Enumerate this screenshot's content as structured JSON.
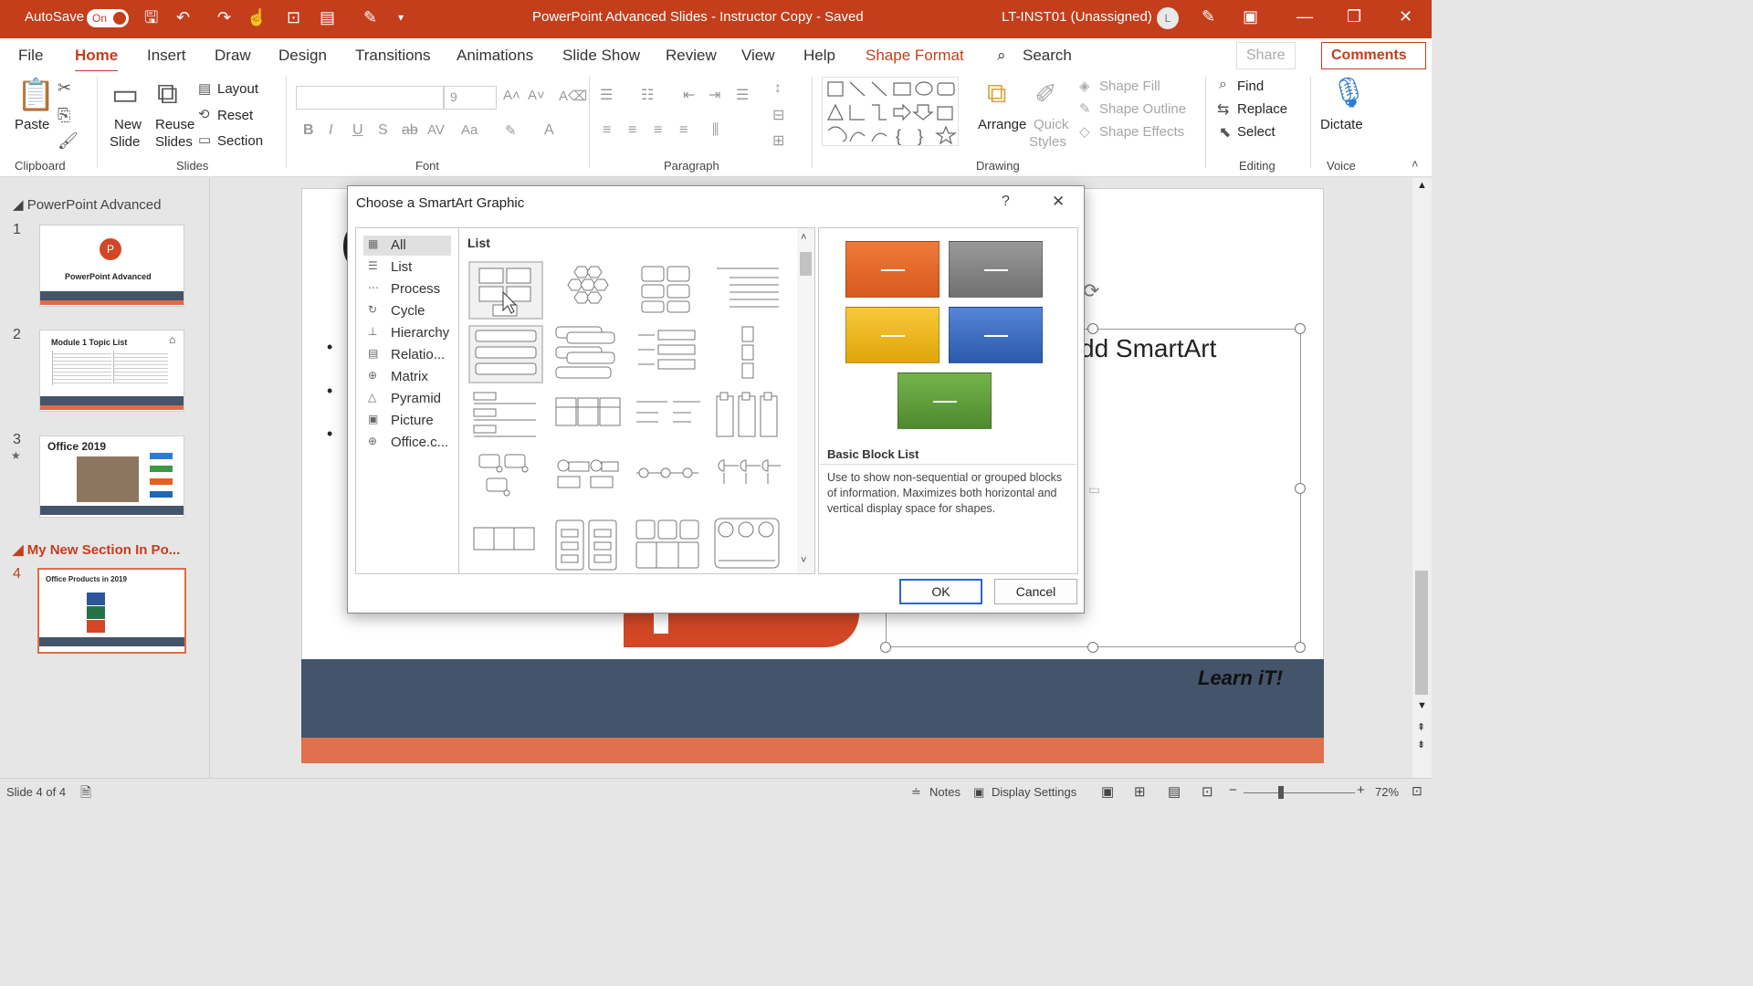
{
  "titlebar": {
    "autosave": "AutoSave",
    "toggle": "On",
    "doc": "PowerPoint Advanced Slides - Instructor Copy - Saved",
    "user": "LT-INST01 (Unassigned)",
    "avatar": "L"
  },
  "tabs": [
    "File",
    "Home",
    "Insert",
    "Draw",
    "Design",
    "Transitions",
    "Animations",
    "Slide Show",
    "Review",
    "View",
    "Help",
    "Shape Format"
  ],
  "search": "Search",
  "share": "Share",
  "comments": "Comments",
  "ribbon": {
    "paste": "Paste",
    "new_slide_1": "New",
    "new_slide_2": "Slide",
    "reuse_1": "Reuse",
    "reuse_2": "Slides",
    "layout": "Layout",
    "reset": "Reset",
    "section": "Section",
    "font_size": "9",
    "shape_fill": "Shape Fill",
    "shape_outline": "Shape Outline",
    "shape_effects": "Shape Effects",
    "arrange": "Arrange",
    "quick_1": "Quick",
    "quick_2": "Styles",
    "find": "Find",
    "replace": "Replace",
    "select": "Select",
    "dictate": "Dictate",
    "groups": {
      "clipboard": "Clipboard",
      "slides": "Slides",
      "font": "Font",
      "paragraph": "Paragraph",
      "drawing": "Drawing",
      "editing": "Editing",
      "voice": "Voice"
    }
  },
  "sections": {
    "s1": "PowerPoint Advanced",
    "s2": "My New Section In Po..."
  },
  "slides": [
    {
      "num": "1",
      "title": "PowerPoint Advanced"
    },
    {
      "num": "2",
      "title": "Module 1 Topic List"
    },
    {
      "num": "3",
      "title": "Office 2019"
    },
    {
      "num": "4",
      "title": "Office Products in 2019"
    }
  ],
  "slide_content": {
    "smartart_text": "dd SmartArt",
    "learn_it": "Learn iT!"
  },
  "dialog": {
    "title": "Choose a SmartArt Graphic",
    "help": "?",
    "close": "✕",
    "categories": [
      "All",
      "List",
      "Process",
      "Cycle",
      "Hierarchy",
      "Relatio...",
      "Matrix",
      "Pyramid",
      "Picture",
      "Office.c..."
    ],
    "gallery_title": "List",
    "preview_name": "Basic Block List",
    "preview_desc": "Use to show non-sequential or grouped blocks of information. Maximizes both horizontal and vertical display space for shapes.",
    "ok": "OK",
    "cancel": "Cancel",
    "preview_colors": [
      "#e5692b",
      "#808080",
      "#f2b81c",
      "#3f6fbf",
      "#5e9c3a"
    ]
  },
  "status": {
    "slide": "Slide 4 of 4",
    "notes": "Notes",
    "display": "Display Settings",
    "zoom": "72%"
  }
}
